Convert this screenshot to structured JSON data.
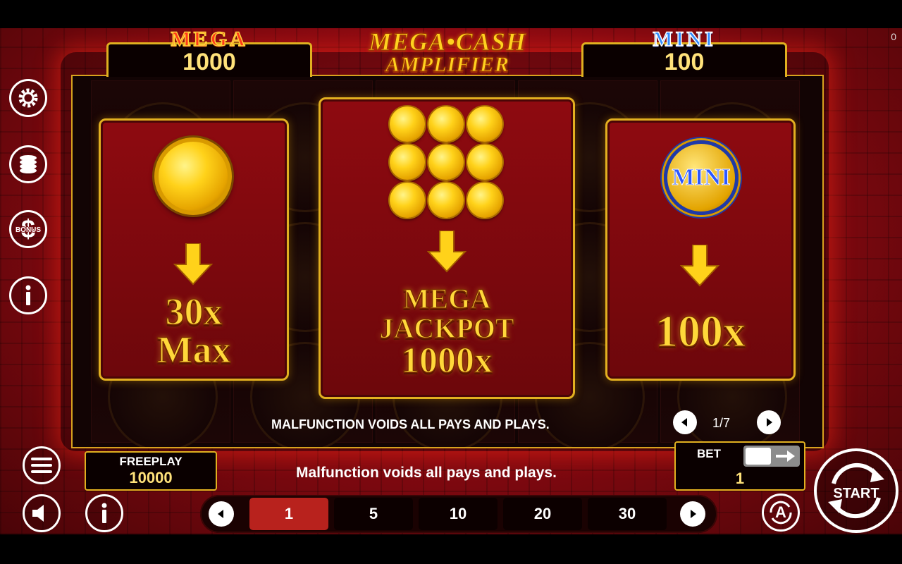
{
  "jackpots": {
    "mega": {
      "label": "MEGA",
      "value": "1000"
    },
    "mini": {
      "label": "MINI",
      "value": "100"
    }
  },
  "logo": {
    "line1": "MEGA•CASH",
    "line2": "AMPLIFIER"
  },
  "corner_counter": "0",
  "panels": [
    {
      "id": "coin",
      "line1": "30x",
      "line2": "Max"
    },
    {
      "id": "nine-coins",
      "line1": "MEGA",
      "line2": "JACKPOT",
      "line3": "1000x"
    },
    {
      "id": "mini-coin",
      "coin_label": "MINI",
      "line1": "100x"
    }
  ],
  "reel_message": "MALFUNCTION VOIDS ALL PAYS AND PLAYS.",
  "pagination": {
    "current": 1,
    "total": 7,
    "text": "1/7"
  },
  "side_icons": [
    "gear-icon",
    "coin-stack-icon",
    "bonus-dollar-icon",
    "info-icon"
  ],
  "bonus_icon_text": "BONUS",
  "freeplay": {
    "label": "FREEPLAY",
    "value": "10000"
  },
  "bottom_message": "Malfunction voids all pays and plays.",
  "bet": {
    "label": "BET",
    "value": "1"
  },
  "bet_options": [
    "1",
    "5",
    "10",
    "20",
    "30"
  ],
  "selected_bet": "1",
  "start_label": "START",
  "auto_label": "A",
  "colors": {
    "accent_gold": "#e0b020",
    "panel_red": "#8e0a10",
    "selected_bet": "#b8221d"
  }
}
